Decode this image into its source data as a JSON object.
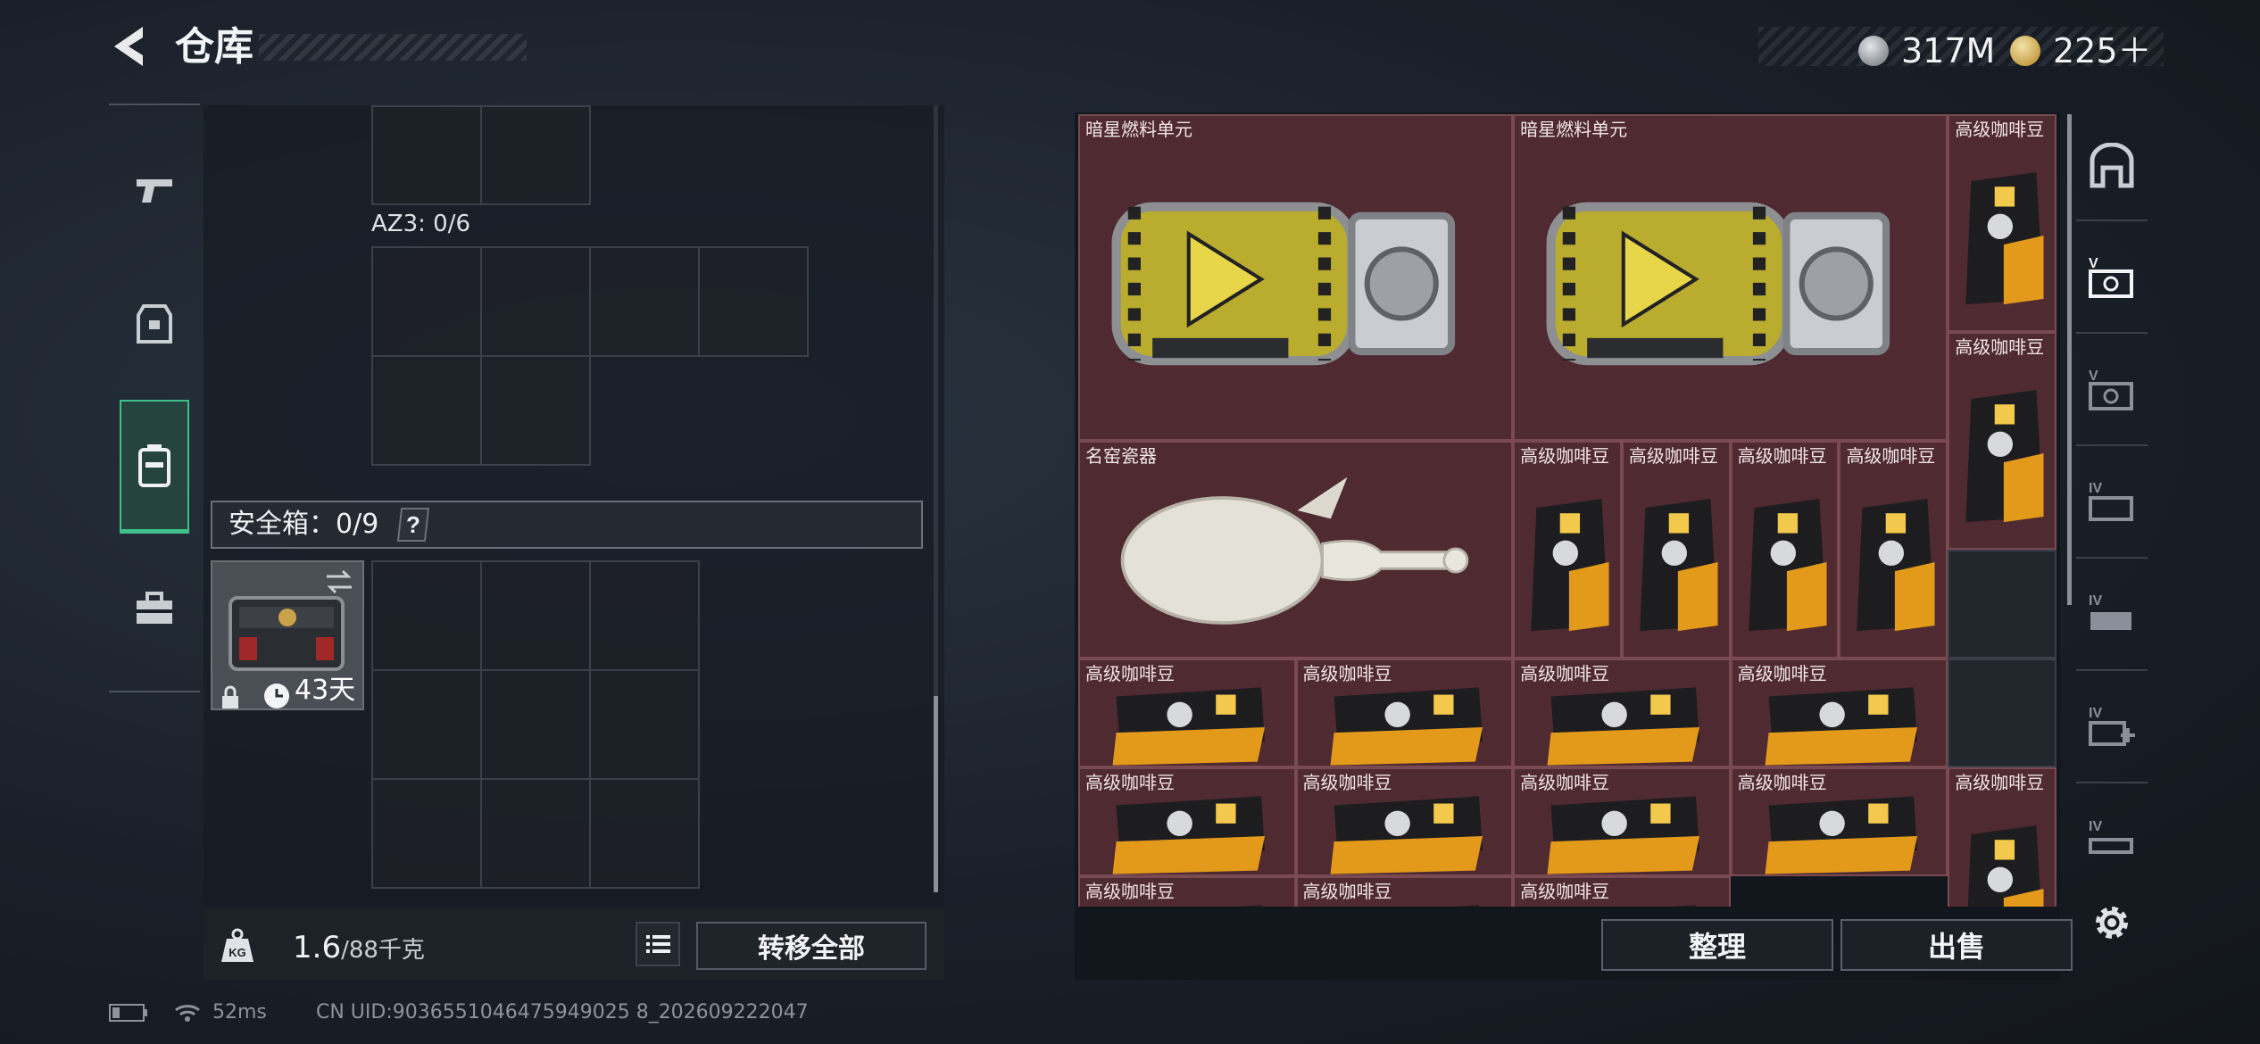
{
  "header": {
    "title": "仓库",
    "currency": [
      {
        "icon": "silver-coin-icon",
        "value": "317M"
      },
      {
        "icon": "gold-coin-icon",
        "value": "225＋"
      }
    ]
  },
  "left": {
    "az_label": "AZ3: 0/6",
    "safebox": {
      "label": "安全箱：0/9",
      "help": "?",
      "days": "43天"
    },
    "weight_current": "1.6",
    "weight_max": "/88千克",
    "transfer_all": "转移全部"
  },
  "inventory": {
    "items": [
      {
        "name": "暗星燃料单元",
        "kind": "fuel"
      },
      {
        "name": "暗星燃料单元",
        "kind": "fuel"
      },
      {
        "name": "高级咖啡豆",
        "kind": "coffee"
      },
      {
        "name": "高级咖啡豆",
        "kind": "coffee"
      },
      {
        "name": "名窑瓷器",
        "kind": "porcelain"
      },
      {
        "name": "高级咖啡豆",
        "kind": "coffee"
      },
      {
        "name": "高级咖啡豆",
        "kind": "coffee"
      },
      {
        "name": "高级咖啡豆",
        "kind": "coffee"
      },
      {
        "name": "高级咖啡豆",
        "kind": "coffee"
      },
      {
        "name": "高级咖啡豆",
        "kind": "coffee-wide"
      },
      {
        "name": "高级咖啡豆",
        "kind": "coffee-wide"
      },
      {
        "name": "高级咖啡豆",
        "kind": "coffee-wide"
      },
      {
        "name": "高级咖啡豆",
        "kind": "coffee-wide"
      },
      {
        "name": "高级咖啡豆",
        "kind": "coffee-wide"
      },
      {
        "name": "高级咖啡豆",
        "kind": "coffee-wide"
      },
      {
        "name": "高级咖啡豆",
        "kind": "coffee-wide"
      },
      {
        "name": "高级咖啡豆",
        "kind": "coffee-wide"
      },
      {
        "name": "高级咖啡豆",
        "kind": "coffee"
      },
      {
        "name": "高级咖啡豆",
        "kind": "coffee-wide"
      },
      {
        "name": "高级咖啡豆",
        "kind": "coffee-wide"
      },
      {
        "name": "高级咖啡豆",
        "kind": "coffee-wide"
      }
    ],
    "sort_button": "整理",
    "sell_button": "出售"
  },
  "status": {
    "ping": "52ms",
    "uid": "CN UID:9036551046475949025 8_202609222047"
  },
  "colors": {
    "accent_green": "#3fc08a",
    "item_bg": "#4f2a30",
    "item_border": "#7a4a52"
  }
}
